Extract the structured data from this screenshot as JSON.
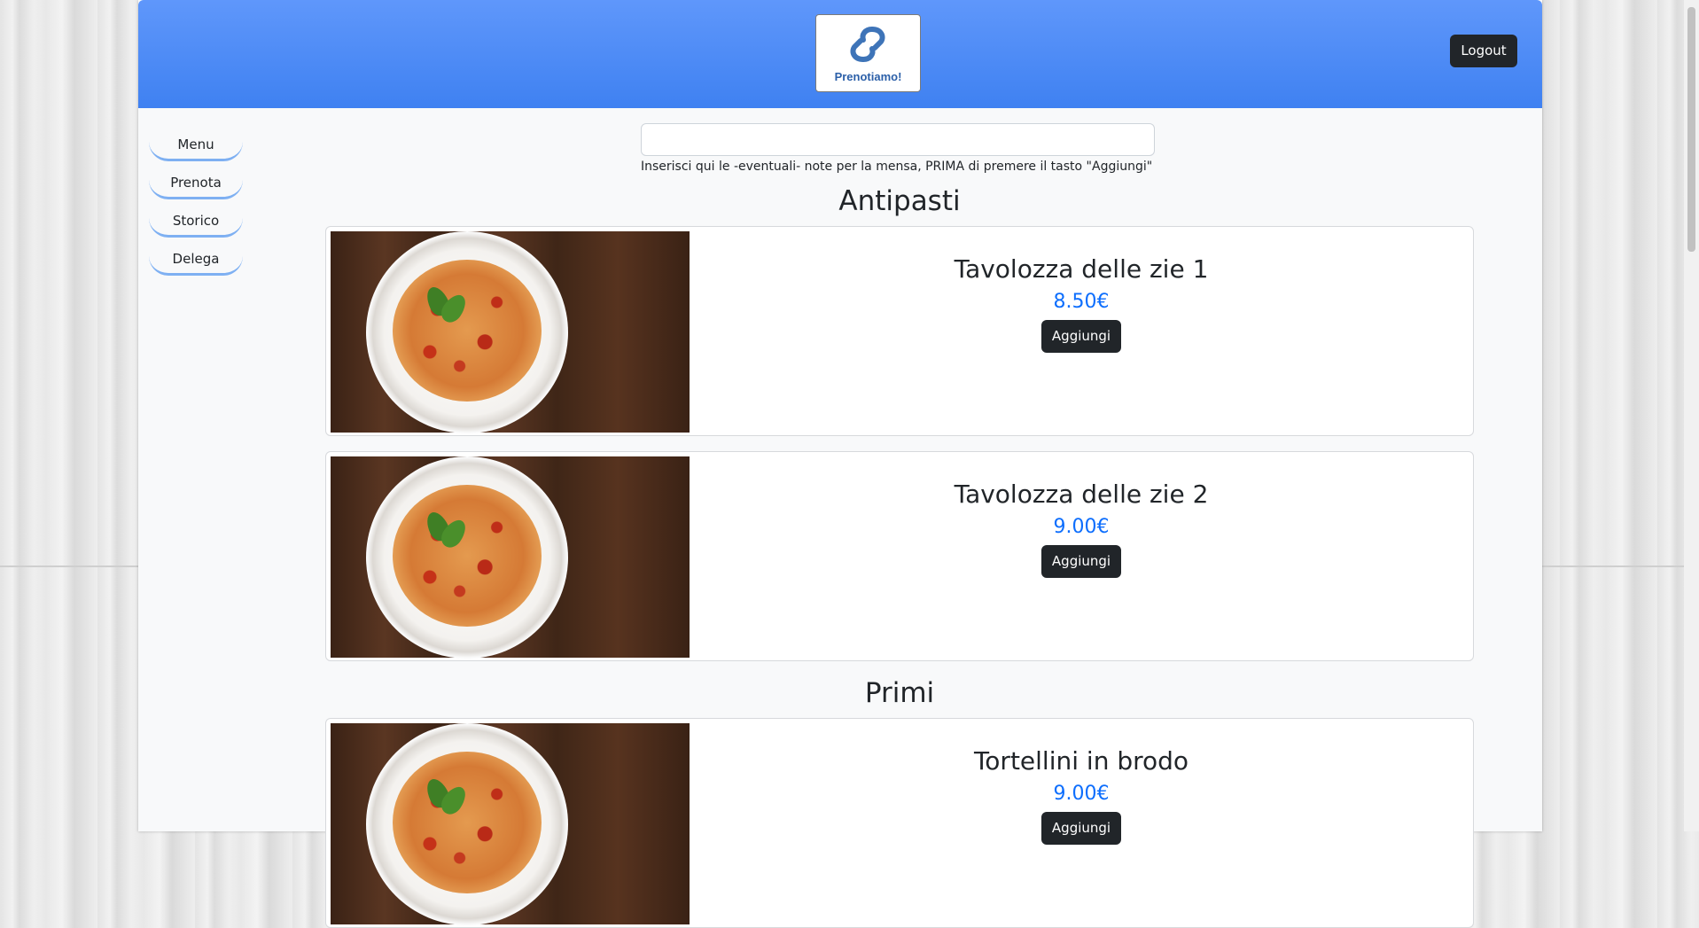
{
  "header": {
    "logo_text": "Prenotiamo!",
    "logout_label": "Logout"
  },
  "sidebar": {
    "items": [
      {
        "label": "Menu"
      },
      {
        "label": "Prenota"
      },
      {
        "label": "Storico"
      },
      {
        "label": "Delega"
      }
    ]
  },
  "notes": {
    "value": "",
    "help": "Inserisci qui le -eventuali- note per la mensa, PRIMA di premere il tasto \"Aggiungi\""
  },
  "sections": [
    {
      "title": "Antipasti",
      "dishes": [
        {
          "name": "Tavolozza delle zie 1",
          "price": "8.50€",
          "button": "Aggiungi"
        },
        {
          "name": "Tavolozza delle zie 2",
          "price": "9.00€",
          "button": "Aggiungi"
        }
      ]
    },
    {
      "title": "Primi",
      "dishes": [
        {
          "name": "Tortellini in brodo",
          "price": "9.00€",
          "button": "Aggiungi"
        }
      ]
    }
  ],
  "colors": {
    "header_top": "#5f97fb",
    "header_bottom": "#3f81f1",
    "price": "#0d6efd",
    "button_dark": "#212529",
    "nav_underline": "#7eb0f2"
  }
}
